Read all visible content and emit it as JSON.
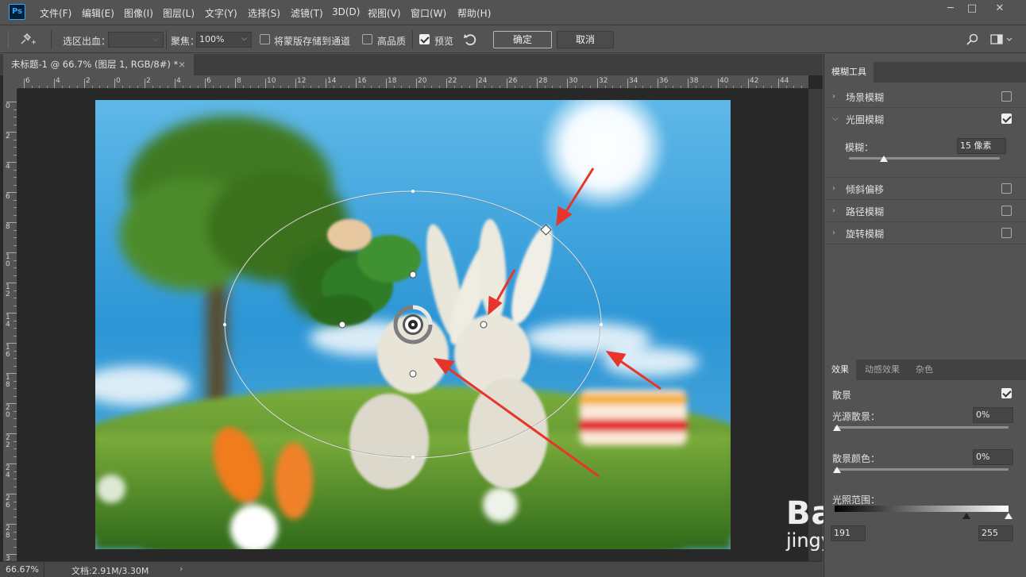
{
  "app": {
    "logo": "Ps"
  },
  "menu": [
    "文件(F)",
    "编辑(E)",
    "图像(I)",
    "图层(L)",
    "文字(Y)",
    "选择(S)",
    "滤镜(T)",
    "3D(D)",
    "视图(V)",
    "窗口(W)",
    "帮助(H)"
  ],
  "window_controls": {
    "minimize": "─",
    "maximize": "□",
    "close": "✕"
  },
  "options": {
    "selection_bleed_label": "选区出血：",
    "focus_label": "聚焦：",
    "focus_value": "100%",
    "save_mask_label": "将蒙版存储到通道",
    "high_quality_label": "高品质",
    "preview_label": "预览",
    "ok_label": "确定",
    "cancel_label": "取消"
  },
  "document_tab": {
    "title": "未标题-1 @ 66.7% (图层 1, RGB/8#) *",
    "close": "×"
  },
  "ruler_h": [
    "6",
    "4",
    "2",
    "0",
    "2",
    "4",
    "6",
    "8",
    "10",
    "12",
    "14",
    "16",
    "18",
    "20",
    "22",
    "24",
    "26",
    "28",
    "30",
    "32",
    "34",
    "36",
    "38",
    "40",
    "42",
    "44",
    "46"
  ],
  "ruler_v": [
    "0",
    "2",
    "4",
    "6",
    "8",
    "1 0",
    "1 2",
    "1 4",
    "1 6",
    "1 8",
    "2 0",
    "2 2",
    "2 4",
    "2 6",
    "2 8",
    "3"
  ],
  "status": {
    "zoom": "66.67%",
    "doc_info": "文档:2.91M/3.30M",
    "arrow": "›"
  },
  "blur_tools": {
    "tab": "模糊工具",
    "items": [
      {
        "label": "场景模糊",
        "expanded": false,
        "checked": false
      },
      {
        "label": "光圈模糊",
        "expanded": true,
        "checked": true
      },
      {
        "label": "倾斜偏移",
        "expanded": false,
        "checked": false
      },
      {
        "label": "路径模糊",
        "expanded": false,
        "checked": false
      },
      {
        "label": "旋转模糊",
        "expanded": false,
        "checked": false
      }
    ],
    "blur_label": "模糊：",
    "blur_value": "15 像素",
    "blur_amount_fraction": 0.23
  },
  "effects": {
    "tabs": [
      "效果",
      "动感效果",
      "杂色"
    ],
    "bokeh_label": "散景",
    "bokeh_checked": true,
    "light_bokeh_label": "光源散景：",
    "light_bokeh_value": "0%",
    "bokeh_color_label": "散景颜色：",
    "bokeh_color_value": "0%",
    "light_range_label": "光照范围：",
    "light_range_low": "191",
    "light_range_high": "255"
  },
  "watermark": {
    "text": "Baidu经验",
    "url": "jingyan.baidu.com"
  },
  "colors": {
    "accent_arrow": "#e8352c",
    "ps_blue": "#31a8ff",
    "sky": "#2a9ad8",
    "grass": "#4c8a26"
  }
}
